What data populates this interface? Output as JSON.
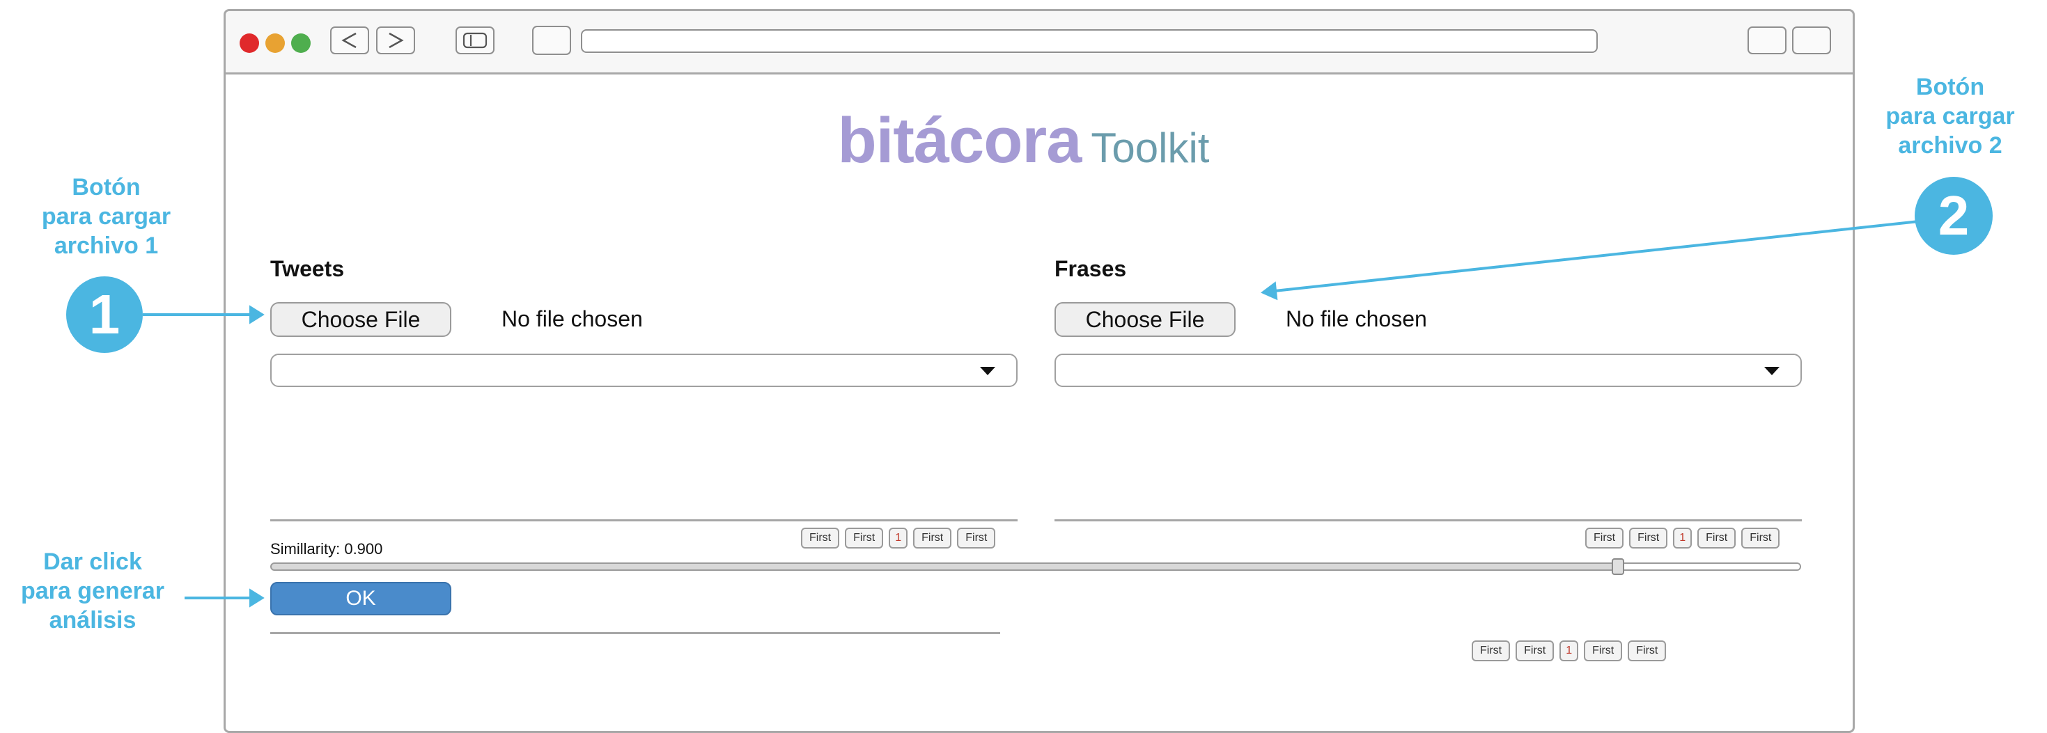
{
  "brand": {
    "name": "bitácora",
    "suffix": "Toolkit",
    "colors": {
      "name": "#a59bd4",
      "suffix": "#6b9cac"
    }
  },
  "window_controls": {
    "close_color": "#e0292b",
    "minimize_color": "#e8a232",
    "maximize_color": "#4fae4e"
  },
  "tweets": {
    "label": "Tweets",
    "choose_button": "Choose File",
    "file_status": "No file chosen",
    "pagination": [
      "First",
      "First",
      "1",
      "First",
      "First"
    ]
  },
  "frases": {
    "label": "Frases",
    "choose_button": "Choose File",
    "file_status": "No file chosen",
    "pagination": [
      "First",
      "First",
      "1",
      "First",
      "First"
    ]
  },
  "similarity": {
    "label": "Simillarity: 0.900",
    "value": 0.9
  },
  "ok_button": {
    "label": "OK",
    "color": "#4a8bcb"
  },
  "results": {
    "pagination": [
      "First",
      "First",
      "1",
      "First",
      "First"
    ]
  },
  "annotations": {
    "color": "#4bb6e1",
    "note1": {
      "number": "1",
      "lines": [
        "Botón",
        "para cargar",
        "archivo 1"
      ]
    },
    "note2": {
      "number": "2",
      "lines": [
        "Botón",
        "para cargar",
        "archivo 2"
      ]
    },
    "note3": {
      "lines": [
        "Dar click",
        "para generar",
        "análisis"
      ]
    }
  }
}
